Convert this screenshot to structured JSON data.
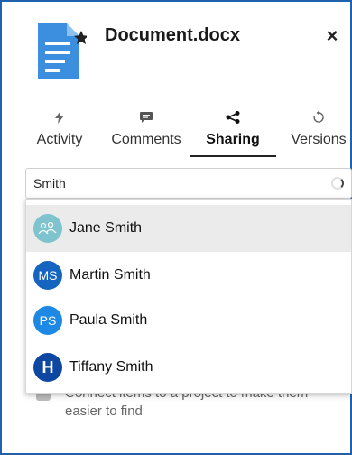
{
  "document": {
    "title": "Document.docx",
    "close_label": "×",
    "icon": "word-document-icon",
    "accent_color": "#3c8fde"
  },
  "tabs": [
    {
      "label": "Activity",
      "icon": "bolt-icon",
      "active": false
    },
    {
      "label": "Comments",
      "icon": "comment-icon",
      "active": false
    },
    {
      "label": "Sharing",
      "icon": "share-icon",
      "active": true
    },
    {
      "label": "Versions",
      "icon": "history-icon",
      "active": false
    }
  ],
  "search": {
    "value": "Smith",
    "status_icon": "loading-spinner-icon"
  },
  "results": [
    {
      "name": "Jane Smith",
      "avatar_initials": "",
      "avatar_icon": "group-avatar-icon",
      "avatar_color": "#7ec3cd",
      "highlighted": true
    },
    {
      "name": "Martin Smith",
      "avatar_initials": "MS",
      "avatar_color": "#1565c0",
      "highlighted": false
    },
    {
      "name": "Paula Smith",
      "avatar_initials": "PS",
      "avatar_color": "#1e88e5",
      "highlighted": false
    },
    {
      "name": "Tiffany Smith",
      "avatar_initials": "H",
      "avatar_color": "#0d47a1",
      "highlighted": false
    }
  ],
  "hint": {
    "text_line1": "Connect items to a project to make them",
    "text_line2": "easier to find"
  }
}
